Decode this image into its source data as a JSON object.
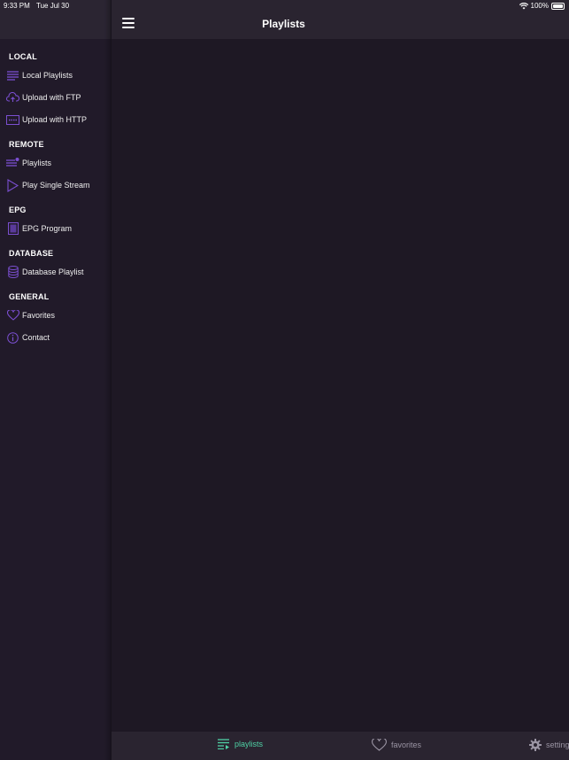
{
  "status_bar": {
    "time": "9:33 PM",
    "date": "Tue Jul 30",
    "battery": "100%"
  },
  "sidebar": {
    "sections": [
      {
        "title": "LOCAL",
        "items": [
          {
            "label": "Local Playlists",
            "icon": "playlist-icon"
          },
          {
            "label": "Upload with FTP",
            "icon": "cloud-upload-icon"
          },
          {
            "label": "Upload with HTTP",
            "icon": "http-icon"
          }
        ]
      },
      {
        "title": "REMOTE",
        "items": [
          {
            "label": "Playlists",
            "icon": "remote-playlist-icon"
          },
          {
            "label": "Play Single Stream",
            "icon": "play-icon"
          }
        ]
      },
      {
        "title": "EPG",
        "items": [
          {
            "label": "EPG Program",
            "icon": "epg-icon"
          }
        ]
      },
      {
        "title": "DATABASE",
        "items": [
          {
            "label": "Database Playlist",
            "icon": "database-icon"
          }
        ]
      },
      {
        "title": "GENERAL",
        "items": [
          {
            "label": "Favorites",
            "icon": "heart-icon"
          },
          {
            "label": "Contact",
            "icon": "info-icon"
          }
        ]
      }
    ]
  },
  "header": {
    "title": "Playlists"
  },
  "tab_bar": {
    "tabs": [
      {
        "label": "playlists",
        "icon": "playlist-icon",
        "active": true
      },
      {
        "label": "favorites",
        "icon": "heart-icon",
        "active": false
      },
      {
        "label": "settings",
        "icon": "gear-icon",
        "active": false
      }
    ]
  },
  "colors": {
    "accent": "#7b4fd1",
    "active_tab": "#4fd1a5",
    "background": "#1e1824",
    "sidebar": "#211a29"
  }
}
